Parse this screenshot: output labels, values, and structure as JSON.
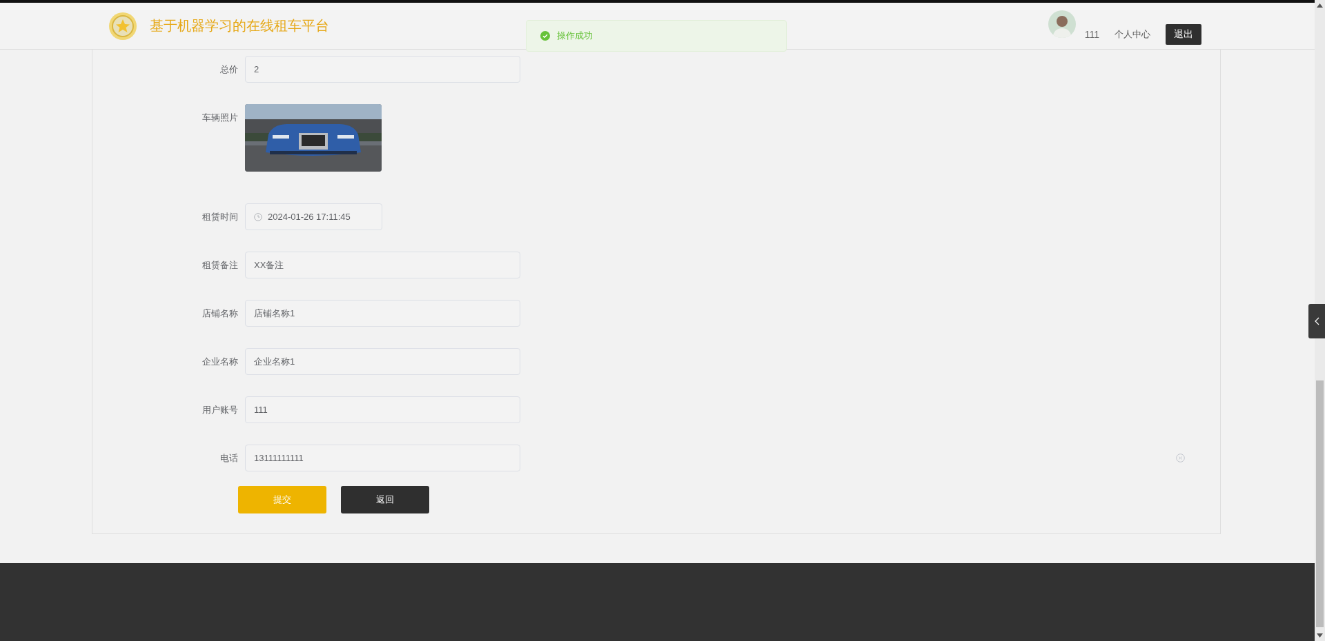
{
  "header": {
    "title": "基于机器学习的在线租车平台",
    "user": {
      "name": "111"
    },
    "links": [
      {
        "label": "个人中心"
      }
    ],
    "logout": "退出"
  },
  "toast": {
    "message": "操作成功"
  },
  "form": {
    "fields": [
      {
        "label": "总价",
        "kind": "text",
        "value": "2"
      },
      {
        "label": "车辆照片",
        "kind": "picture"
      },
      {
        "label": "租赁时间",
        "kind": "datetime",
        "value": "2024-01-26 17:11:45"
      },
      {
        "label": "租赁备注",
        "kind": "text",
        "value": "XX备注"
      },
      {
        "label": "店铺名称",
        "kind": "text",
        "value": "店铺名称1"
      },
      {
        "label": "企业名称",
        "kind": "text",
        "value": "企业名称1"
      },
      {
        "label": "用户账号",
        "kind": "text",
        "value": "111"
      },
      {
        "label": "电话",
        "kind": "text",
        "value": "13111111111"
      }
    ],
    "buttons": [
      {
        "label": "提交",
        "kind": "primary"
      },
      {
        "label": "返回",
        "kind": "dark"
      }
    ]
  }
}
